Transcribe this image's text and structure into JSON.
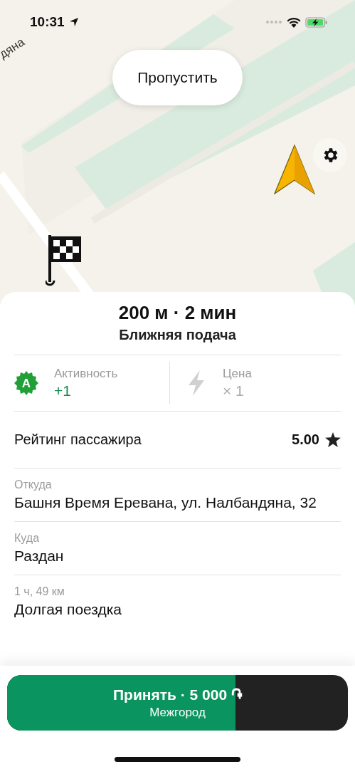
{
  "status_bar": {
    "time": "10:31"
  },
  "map": {
    "street_label": "дяна",
    "skip_button": "Пропустить"
  },
  "summary": {
    "distance_time": "200 м · 2 мин",
    "pickup_type": "Ближняя подача"
  },
  "stats": [
    {
      "kind": "activity",
      "badge": "A",
      "label": "Активность",
      "value": "+1"
    },
    {
      "kind": "surge",
      "label": "Цена",
      "value": "× 1"
    }
  ],
  "rating": {
    "label": "Рейтинг пассажира",
    "value": "5.00"
  },
  "route": [
    {
      "label": "Откуда",
      "value": "Башня Время Еревана, ул. Налбандяна, 32"
    },
    {
      "label": "Куда",
      "value": "Раздан"
    },
    {
      "label": "1 ч, 49 км",
      "value": "Долгая поездка"
    }
  ],
  "accept_button": {
    "title": "Принять · 5 000 ֏",
    "subtitle": "Межгород",
    "level": 0.67
  }
}
